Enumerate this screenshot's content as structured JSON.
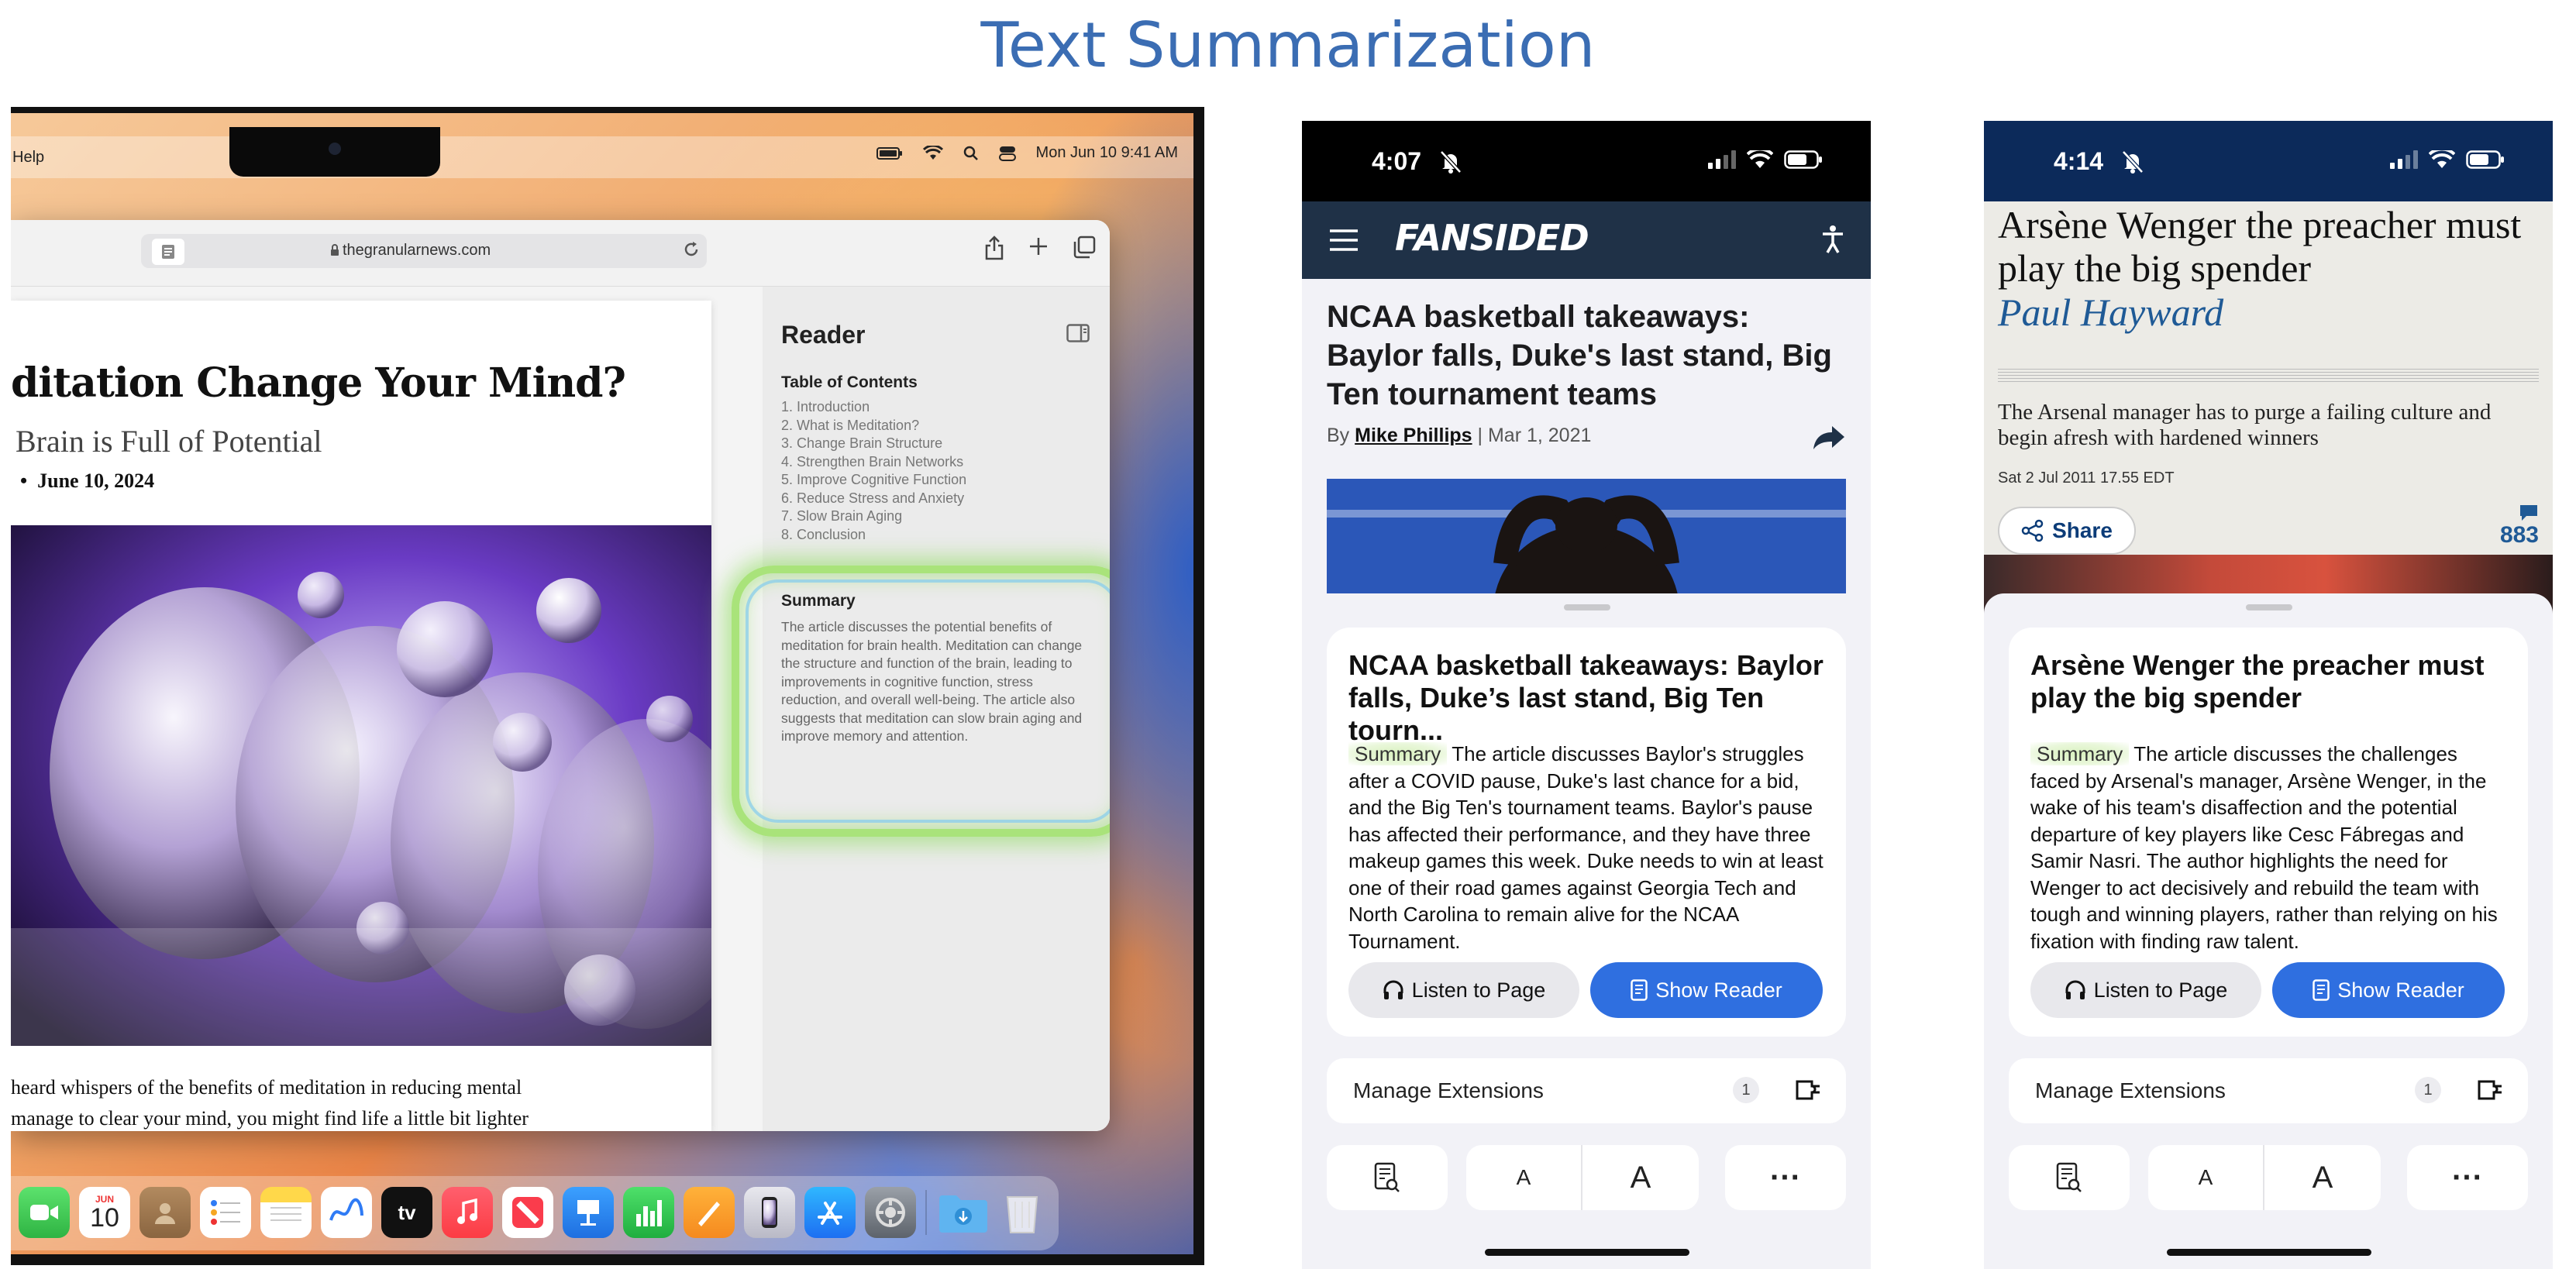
{
  "page_title": "Text Summarization",
  "mac": {
    "menu": {
      "help": "Help",
      "clock": "Mon Jun 10  9:41 AM"
    },
    "browser": {
      "url": "thegranularnews.com"
    },
    "article": {
      "title": "ditation Change Your Mind?",
      "subtitle": "Brain is Full of Potential",
      "date": "June 10, 2024",
      "body_line1": "heard whispers of the benefits of meditation in reducing mental",
      "body_line2": "manage to clear your mind, you might find life a little bit lighter"
    },
    "reader": {
      "title": "Reader",
      "toc_title": "Table of Contents",
      "toc": [
        "1.  Introduction",
        "2.  What is Meditation?",
        "3.  Change Brain Structure",
        "4.  Strengthen Brain Networks",
        "5.  Improve Cognitive Function",
        "6.  Reduce Stress and Anxiety",
        "7.  Slow Brain Aging",
        "8.  Conclusion"
      ],
      "summary_title": "Summary",
      "summary": "The article discusses the potential benefits of meditation for brain health. Meditation can change the structure and function of the brain, leading to improvements in cognitive function, stress reduction, and overall well-being. The article also suggests that meditation can slow brain aging and improve memory and attention."
    },
    "dock": {
      "calendar_month": "JUN",
      "calendar_day": "10",
      "tv_label": "tv"
    }
  },
  "phone1": {
    "time": "4:07",
    "brand": "FANSIDED",
    "headline": "NCAA basketball takeaways: Baylor falls, Duke's last stand, Big Ten tournament teams",
    "byline_prefix": "By",
    "author": "Mike Phillips",
    "byline_date": "| Mar 1, 2021",
    "card_title": "NCAA basketball takeaways: Baylor falls, Duke’s last stand, Big Ten tourn...",
    "summary_label": "Summary",
    "summary": "The article discusses Baylor's struggles after a COVID pause, Duke's last chance for a bid, and the Big Ten's tournament teams. Baylor's pause has affected their performance, and they have three makeup games this week. Duke needs to win at least one of their road games against Georgia Tech and North Carolina to remain alive for the NCAA Tournament.",
    "listen_label": "Listen to Page",
    "reader_label": "Show Reader",
    "manage_label": "Manage Extensions",
    "manage_count": "1",
    "font_small": "A",
    "font_large": "A",
    "more": "···"
  },
  "phone2": {
    "time": "4:14",
    "headline": "Arsène Wenger the preacher must play the big spender",
    "author": "Paul Hayward",
    "standfirst": "The Arsenal manager has to purge a failing culture and begin afresh with hardened winners",
    "date": "Sat 2 Jul 2011 17.55 EDT",
    "share_label": "Share",
    "comments": "883",
    "card_title": "Arsène Wenger the preacher must play the big spender",
    "summary_label": "Summary",
    "summary": "The article discusses the challenges faced by Arsenal's manager, Arsène Wenger, in the wake of his team's disaffection and the potential departure of key players like Cesc Fábregas and Samir Nasri. The author highlights the need for Wenger to act decisively and rebuild the team with tough and winning players, rather than relying on his fixation with finding raw talent.",
    "listen_label": "Listen to Page",
    "reader_label": "Show Reader",
    "manage_label": "Manage Extensions",
    "manage_count": "1",
    "font_small": "A",
    "font_large": "A",
    "more": "···"
  }
}
